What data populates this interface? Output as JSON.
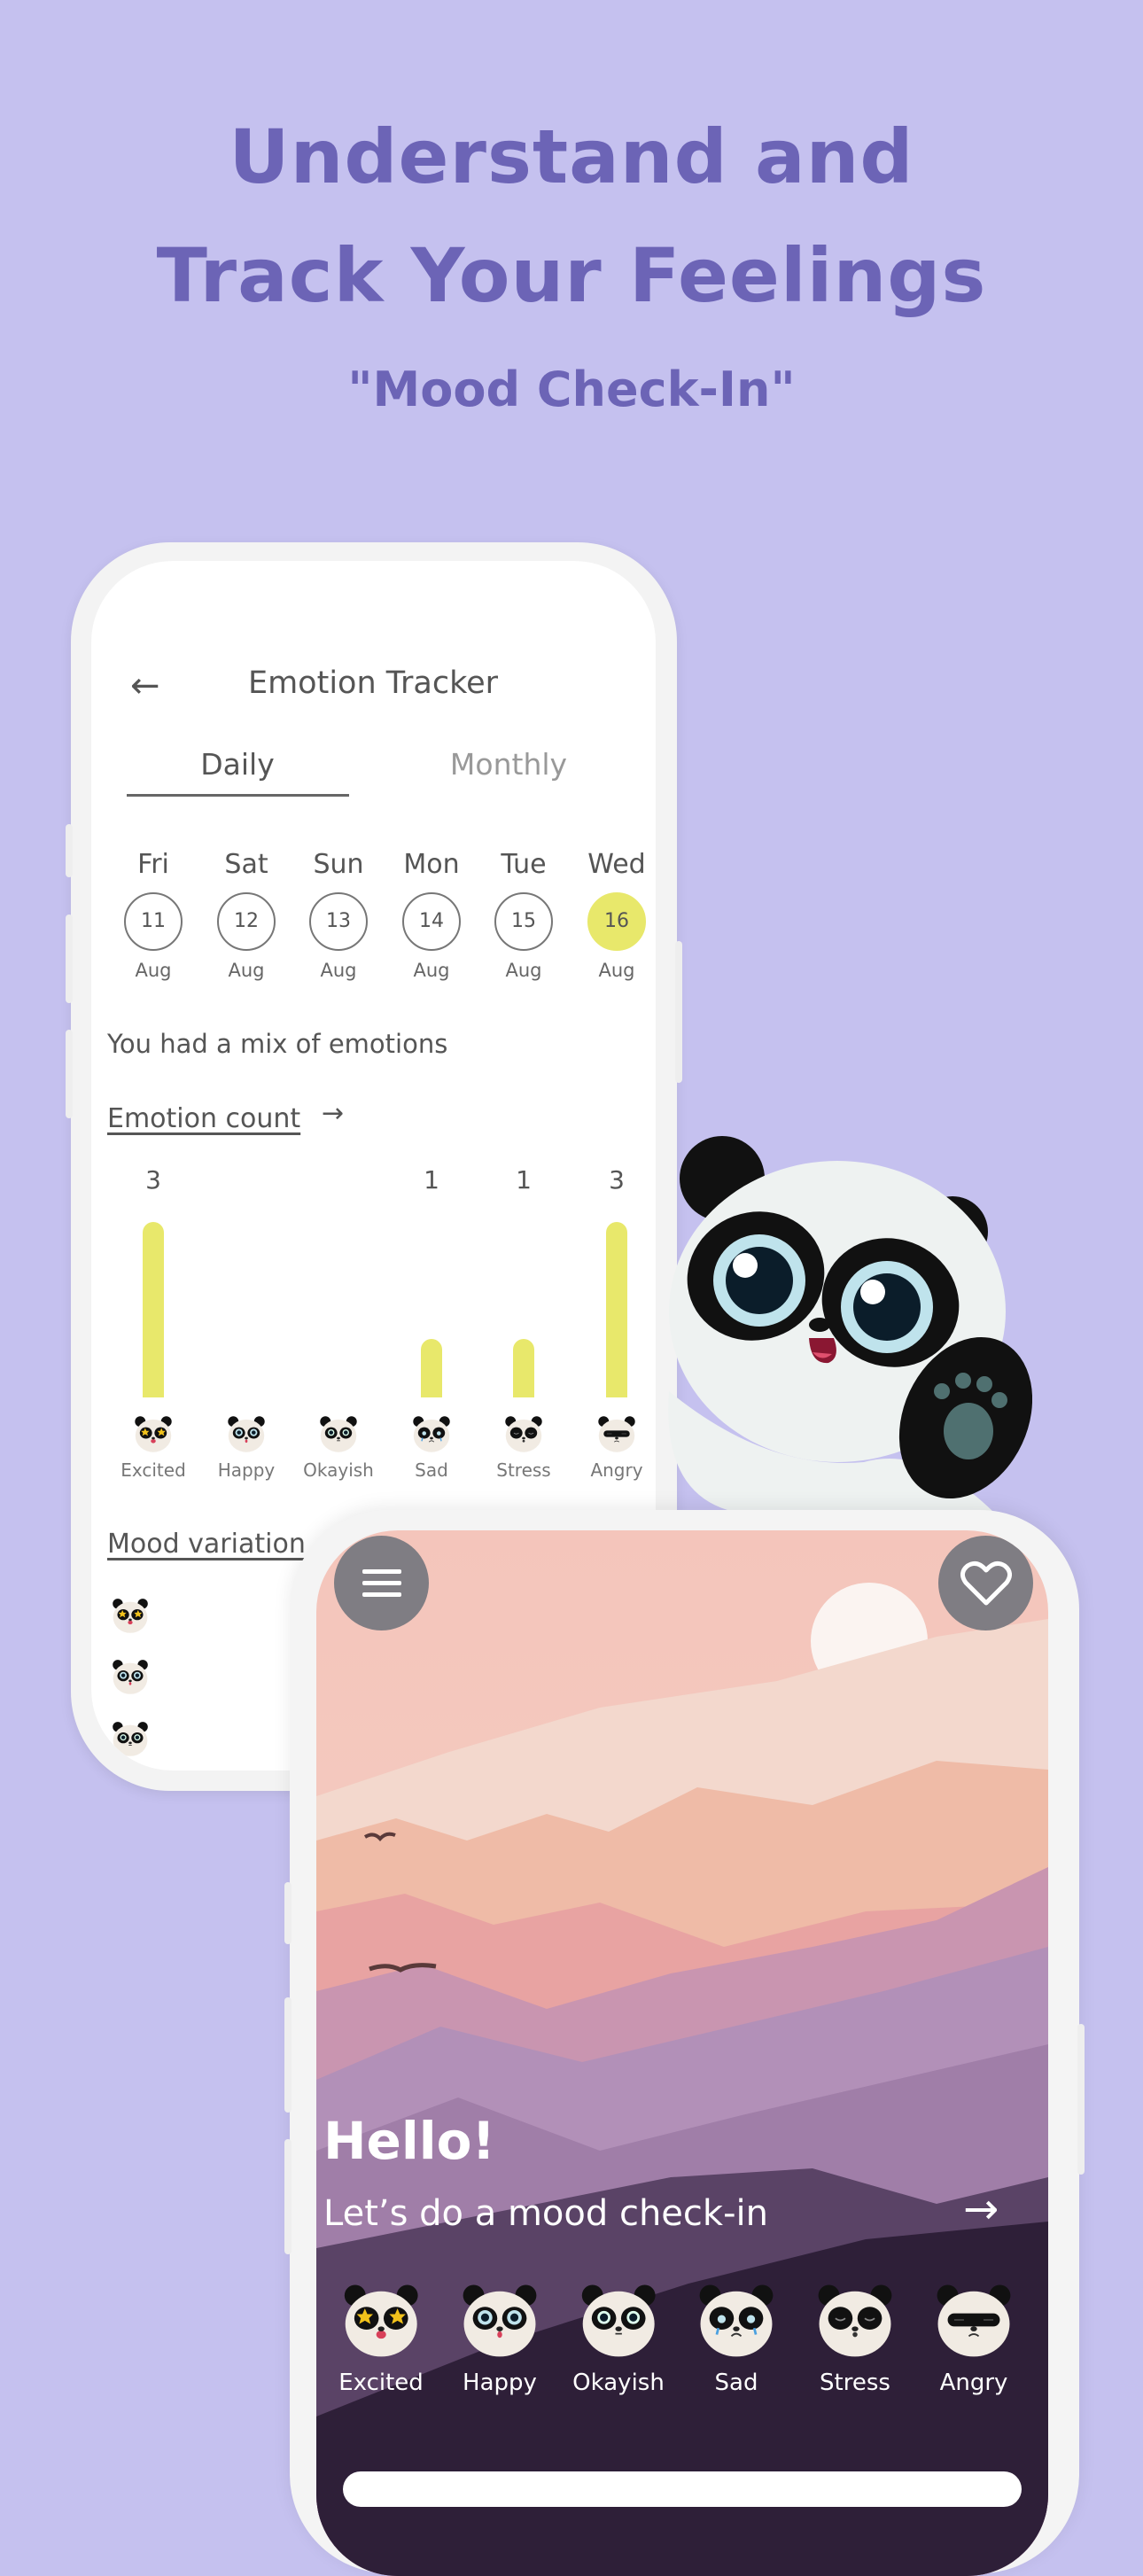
{
  "headline": {
    "line1": "Understand and",
    "line2": "Track Your Feelings",
    "subtitle": "\"Mood Check-In\""
  },
  "colors": {
    "background": "#c5c1ef",
    "headline": "#6c64b6",
    "accent": "#e8e86b"
  },
  "tracker": {
    "back_icon": "arrow-left-icon",
    "title": "Emotion Tracker",
    "tabs": [
      {
        "label": "Daily",
        "active": true
      },
      {
        "label": "Monthly",
        "active": false
      }
    ],
    "days": [
      {
        "name": "Fri",
        "date": "11",
        "month": "Aug",
        "selected": false
      },
      {
        "name": "Sat",
        "date": "12",
        "month": "Aug",
        "selected": false
      },
      {
        "name": "Sun",
        "date": "13",
        "month": "Aug",
        "selected": false
      },
      {
        "name": "Mon",
        "date": "14",
        "month": "Aug",
        "selected": false
      },
      {
        "name": "Tue",
        "date": "15",
        "month": "Aug",
        "selected": false
      },
      {
        "name": "Wed",
        "date": "16",
        "month": "Aug",
        "selected": true
      }
    ],
    "summary": "You had a mix of emotions",
    "emotion_count_link": "Emotion count",
    "arrow": "→",
    "mood_variation_label": "Mood variation"
  },
  "chart_data": {
    "type": "bar",
    "categories": [
      "Excited",
      "Happy",
      "Okayish",
      "Sad",
      "Stress",
      "Angry"
    ],
    "values": [
      3,
      0,
      0,
      1,
      1,
      3
    ],
    "value_labels": [
      "3",
      "",
      "",
      "1",
      "1",
      "3"
    ],
    "ylim": [
      0,
      3
    ],
    "grid": false,
    "bar_color": "#e8e86b"
  },
  "home": {
    "menu_icon": "hamburger-menu-icon",
    "favorite_icon": "heart-icon",
    "greeting": "Hello!",
    "prompt": "Let’s do a mood check-in",
    "arrow": "→",
    "moods": [
      "Excited",
      "Happy",
      "Okayish",
      "Sad",
      "Stress",
      "Angry"
    ]
  }
}
